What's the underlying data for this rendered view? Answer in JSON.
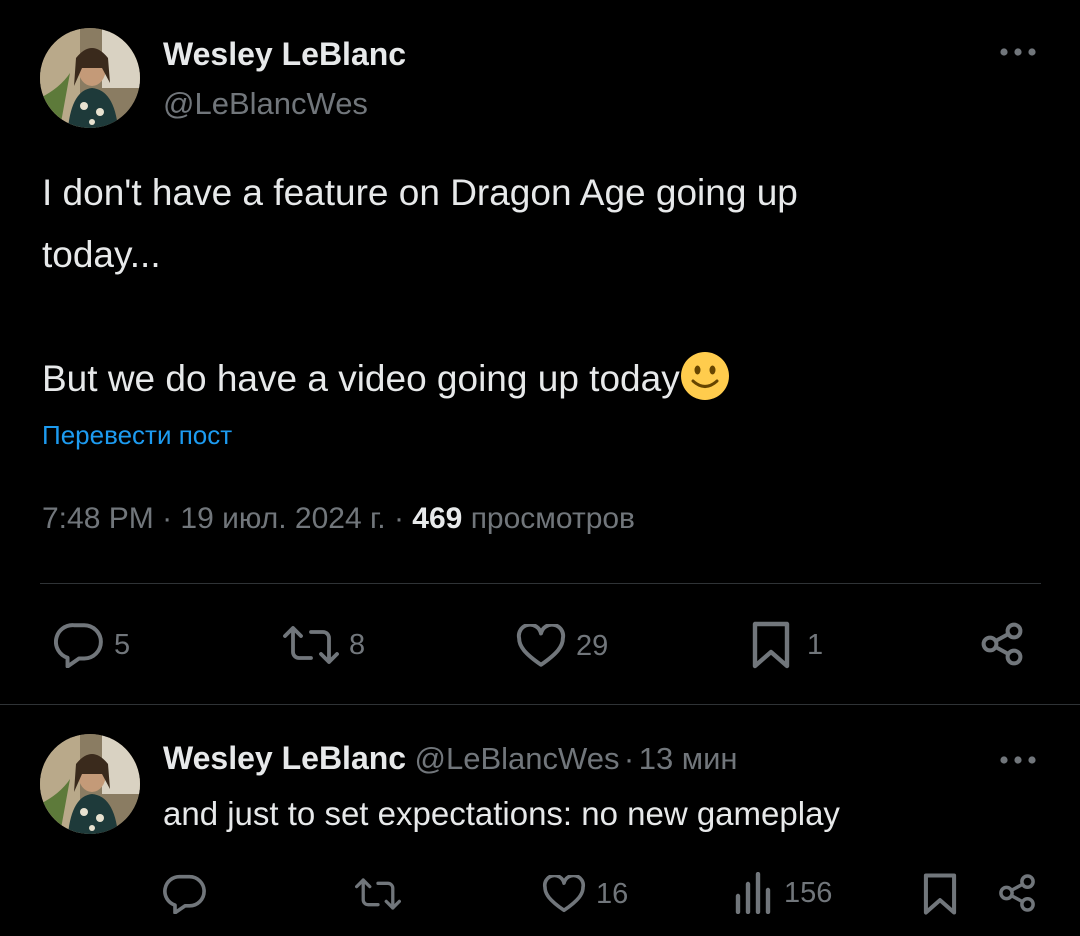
{
  "main_post": {
    "author_name": "Wesley LeBlanc",
    "author_handle": "@LeBlancWes",
    "more_icon": "more-horizontal-icon",
    "text_line1": "I don't have a feature on Dragon Age going up",
    "text_line2": "today...",
    "text_line3": "But we do have a video going up today",
    "emoji": "slightly-smiling-face-emoji",
    "translate_label": "Перевести пост",
    "time": "7:48 PM",
    "separator": "·",
    "date": "19 июл. 2024 г.",
    "views_count": "469",
    "views_label": "просмотров",
    "actions": {
      "replies": "5",
      "reposts": "8",
      "likes": "29",
      "bookmarks": "1"
    }
  },
  "reply_post": {
    "author_name": "Wesley LeBlanc",
    "author_handle": "@LeBlancWes",
    "separator": "·",
    "time_ago": "13 мин",
    "text": "and just to set expectations: no new gameplay",
    "actions": {
      "likes": "16",
      "views": "156"
    }
  },
  "colors": {
    "background": "#000000",
    "text": "#e7e9ea",
    "secondary": "#71767b",
    "link": "#1d9bf0",
    "divider": "#2f3336"
  }
}
